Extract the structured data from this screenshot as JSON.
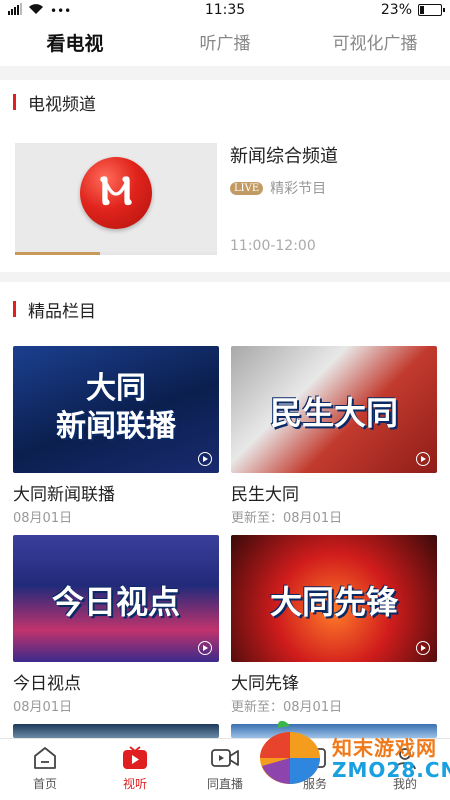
{
  "status_bar": {
    "time": "11:35",
    "battery": "23%",
    "battery_level": 0.23,
    "dots": "•••"
  },
  "top_tabs": [
    {
      "label": "看电视",
      "active": true
    },
    {
      "label": "听广播",
      "active": false
    },
    {
      "label": "可视化广播",
      "active": false
    }
  ],
  "tv_section": {
    "title": "电视频道",
    "channel": {
      "logo_text": "Ⲙ",
      "name": "新闻综合频道",
      "live_badge": "LIVE",
      "program": "精彩节目",
      "time": "11:00-12:00",
      "progress": 0.42
    }
  },
  "featured_section": {
    "title": "精品栏目",
    "items": [
      {
        "thumb_text": "大同\n新闻联播",
        "title": "大同新闻联播",
        "sub": "08月01日"
      },
      {
        "thumb_text": "民生大同",
        "title": "民生大同",
        "sub": "更新至：08月01日"
      },
      {
        "thumb_text": "今日视点",
        "title": "今日视点",
        "sub": "08月01日"
      },
      {
        "thumb_text": "大同先锋",
        "title": "大同先锋",
        "sub": "更新至：08月01日"
      }
    ]
  },
  "bottom_nav": [
    {
      "label": "首页",
      "icon": "home-icon",
      "active": false
    },
    {
      "label": "视听",
      "icon": "tv-icon",
      "active": true
    },
    {
      "label": "同直播",
      "icon": "video-camera-icon",
      "active": false
    },
    {
      "label": "服务",
      "icon": "service-icon",
      "active": false
    },
    {
      "label": "我的",
      "icon": "user-icon",
      "active": false
    }
  ],
  "watermark": {
    "line1": "知末游戏网",
    "line2": "ZMO28.CN"
  },
  "colors": {
    "accent_red": "#e02020",
    "live_gold": "#c29b64"
  }
}
